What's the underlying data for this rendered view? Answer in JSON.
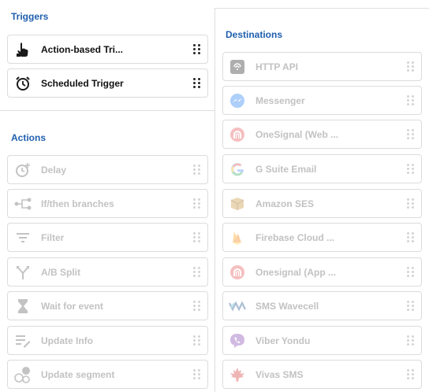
{
  "triggers": {
    "title": "Triggers",
    "items": [
      {
        "label": "Action-based Tri...",
        "icon": "hand-pointer-icon"
      },
      {
        "label": "Scheduled Trigger",
        "icon": "alarm-clock-icon"
      }
    ]
  },
  "actions": {
    "title": "Actions",
    "items": [
      {
        "label": "Delay",
        "icon": "delay-icon"
      },
      {
        "label": "If/then branches",
        "icon": "branches-icon"
      },
      {
        "label": "Filter",
        "icon": "filter-icon"
      },
      {
        "label": "A/B Split",
        "icon": "split-icon"
      },
      {
        "label": "Wait for event",
        "icon": "hourglass-icon"
      },
      {
        "label": "Update Info",
        "icon": "update-info-icon"
      },
      {
        "label": "Update segment",
        "icon": "segment-icon"
      }
    ]
  },
  "destinations": {
    "title": "Destinations",
    "items": [
      {
        "label": "HTTP API",
        "icon": "http-api-icon"
      },
      {
        "label": "Messenger",
        "icon": "messenger-icon"
      },
      {
        "label": "OneSignal (Web ...",
        "icon": "onesignal-icon"
      },
      {
        "label": "G Suite Email",
        "icon": "google-icon"
      },
      {
        "label": "Amazon SES",
        "icon": "amazon-ses-icon"
      },
      {
        "label": "Firebase Cloud ...",
        "icon": "firebase-icon"
      },
      {
        "label": "Onesignal (App ...",
        "icon": "onesignal-icon"
      },
      {
        "label": "SMS Wavecell",
        "icon": "wavecell-icon"
      },
      {
        "label": "Viber Yondu",
        "icon": "viber-icon"
      },
      {
        "label": "Vivas SMS",
        "icon": "vivas-icon"
      }
    ]
  },
  "colors": {
    "section_title": "#1f5fae",
    "active_text": "#111111",
    "disabled_text": "#c2c2c2",
    "border": "#dcdcdc"
  }
}
